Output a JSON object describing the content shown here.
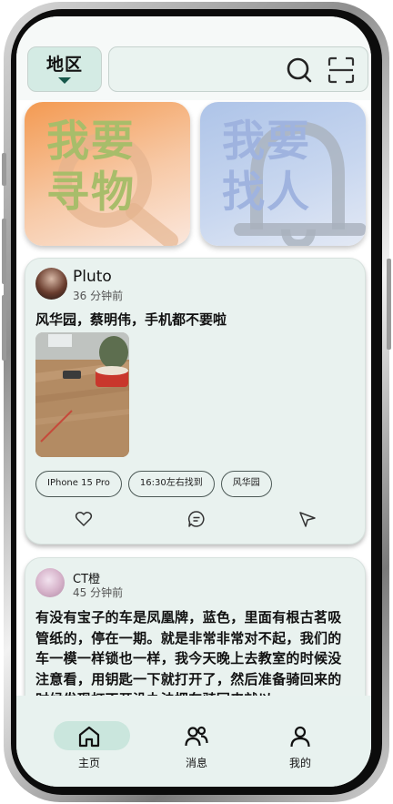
{
  "topbar": {
    "region_label": "地区",
    "search_icon": "search-icon",
    "scan_icon": "scan-icon"
  },
  "features": {
    "find_item": {
      "line1": "我要",
      "line2": "寻物",
      "icon": "magnifier-icon"
    },
    "find_person": {
      "line1": "我要",
      "line2": "找人",
      "icon": "bell-icon"
    }
  },
  "posts": [
    {
      "user": "Pluto",
      "time": "36 分钟前",
      "title": "风华园，蔡明伟，手机都不要啦",
      "tags": [
        "IPhone 15 Pro",
        "16:30左右找到",
        "风华园"
      ],
      "actions": [
        "heart-icon",
        "comment-icon",
        "share-icon"
      ]
    },
    {
      "user": "CT橙",
      "time": "45 分钟前",
      "body": "有没有宝子的车是凤凰牌，蓝色，里面有根古茗吸管纸的，停在一期。就是非常非常对不起，我们的车一模一样锁也一样，我今天晚上去教室的时候没注意看，用钥匙一下就打开了，然后准备骑回来的时候发现打不开没办法把车骑回来就以"
    }
  ],
  "nav": [
    {
      "label": "主页",
      "icon": "home-icon",
      "active": true
    },
    {
      "label": "消息",
      "icon": "people-icon",
      "active": false
    },
    {
      "label": "我的",
      "icon": "person-icon",
      "active": false
    }
  ],
  "colors": {
    "accent": "#17584b",
    "nav_active": "#cae6dd",
    "card_bg": "#e9f2ef"
  }
}
